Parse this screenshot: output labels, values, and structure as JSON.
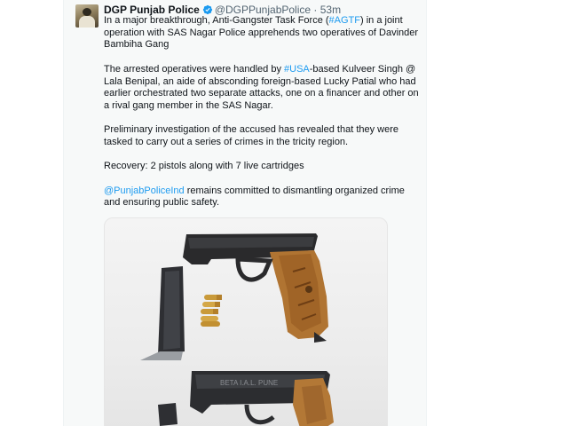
{
  "tweet": {
    "author_name": "DGP Punjab Police",
    "handle": "@DGPPunjabPolice",
    "separator": "·",
    "time": "53m",
    "p1": {
      "before": "In a major breakthrough, Anti-Gangster Task Force (",
      "hashtag": "#AGTF",
      "after": ") in a joint operation with SAS Nagar Police apprehends two operatives of Davinder Bambiha Gang"
    },
    "p2": {
      "before": "The arrested operatives were handled by ",
      "hashtag": "#USA",
      "after": "-based Kulveer Singh @ Lala Benipal, an aide of absconding foreign-based Lucky Patial who had earlier orchestrated two separate attacks, one on a financer and other on a rival gang member in the SAS Nagar."
    },
    "p3": "Preliminary investigation of the accused has revealed that they were tasked to carry out a series of crimes in the tricity region.",
    "p4": "Recovery: 2 pistols along with 7 live cartridges",
    "p5": {
      "mention": "@PunjabPoliceInd",
      "after": " remains committed to dismantling organized crime and ensuring public safety."
    },
    "pistol_engraving": "BETA I.A.L. PUNE"
  },
  "colors": {
    "link": "#1d9bf0",
    "verified": "#1d9bf0",
    "muted": "#536471",
    "text": "#0f1419",
    "column_bg": "#f7f9f9"
  },
  "icons": {
    "verified": "verified-badge-icon"
  }
}
